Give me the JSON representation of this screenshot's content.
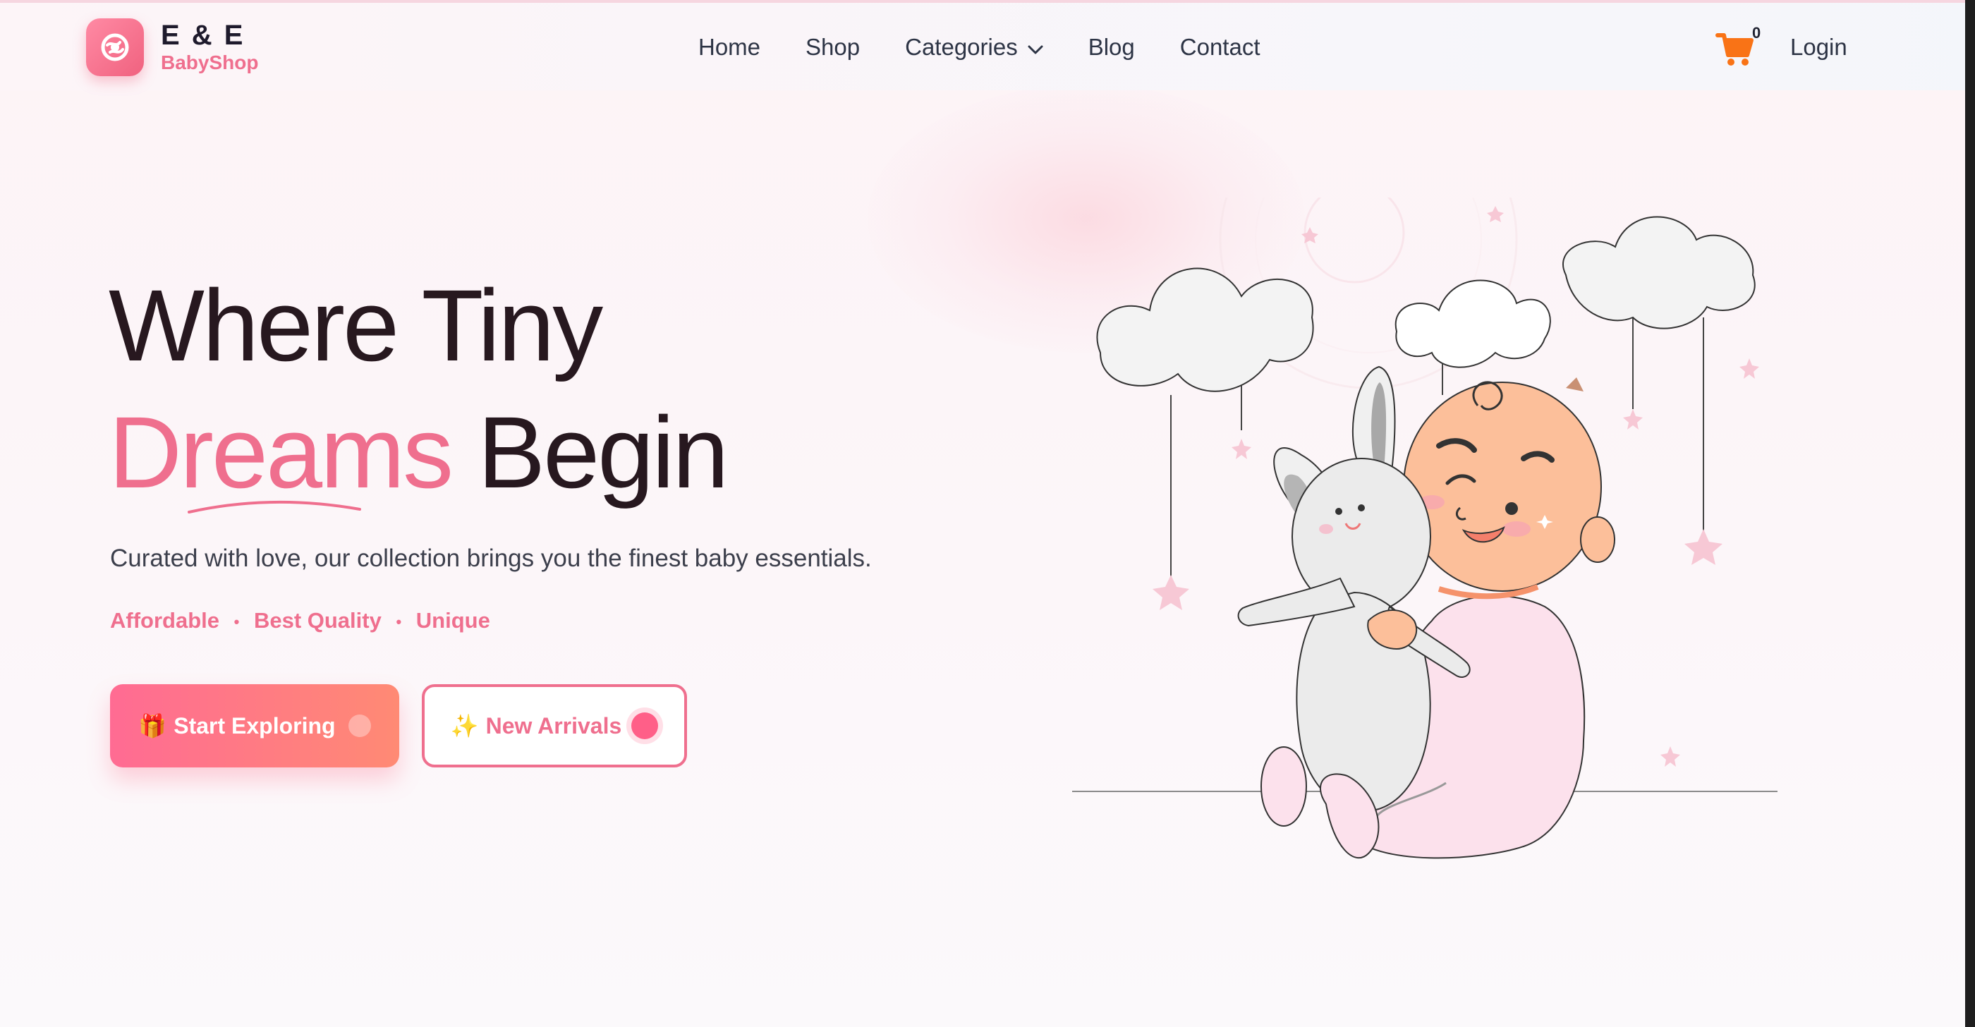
{
  "brand": {
    "title": "E & E",
    "subtitle": "BabyShop"
  },
  "nav": {
    "items": [
      {
        "label": "Home"
      },
      {
        "label": "Shop"
      },
      {
        "label": "Categories"
      },
      {
        "label": "Blog"
      },
      {
        "label": "Contact"
      }
    ]
  },
  "cart": {
    "count": "0",
    "icon": "shopping-cart-icon",
    "color": "#f97316"
  },
  "login": {
    "label": "Login"
  },
  "hero": {
    "title_line1": "Where Tiny",
    "title_accent": "Dreams",
    "title_rest": " Begin",
    "subtitle": "Curated with love, our collection brings you the finest baby essentials.",
    "features": [
      "Affordable",
      "Best Quality",
      "Unique"
    ],
    "feature_separator": "•",
    "primary_button": {
      "icon": "🎁",
      "label": "Start Exploring"
    },
    "secondary_button": {
      "icon": "✨",
      "label": "New Arrivals"
    }
  },
  "colors": {
    "accent": "#ef6f8e",
    "heading": "#27181f",
    "button_gradient_start": "#ff6b93",
    "button_gradient_end": "#ff8a74"
  },
  "illustration": {
    "icon": "baby-with-bunny-illustration"
  }
}
